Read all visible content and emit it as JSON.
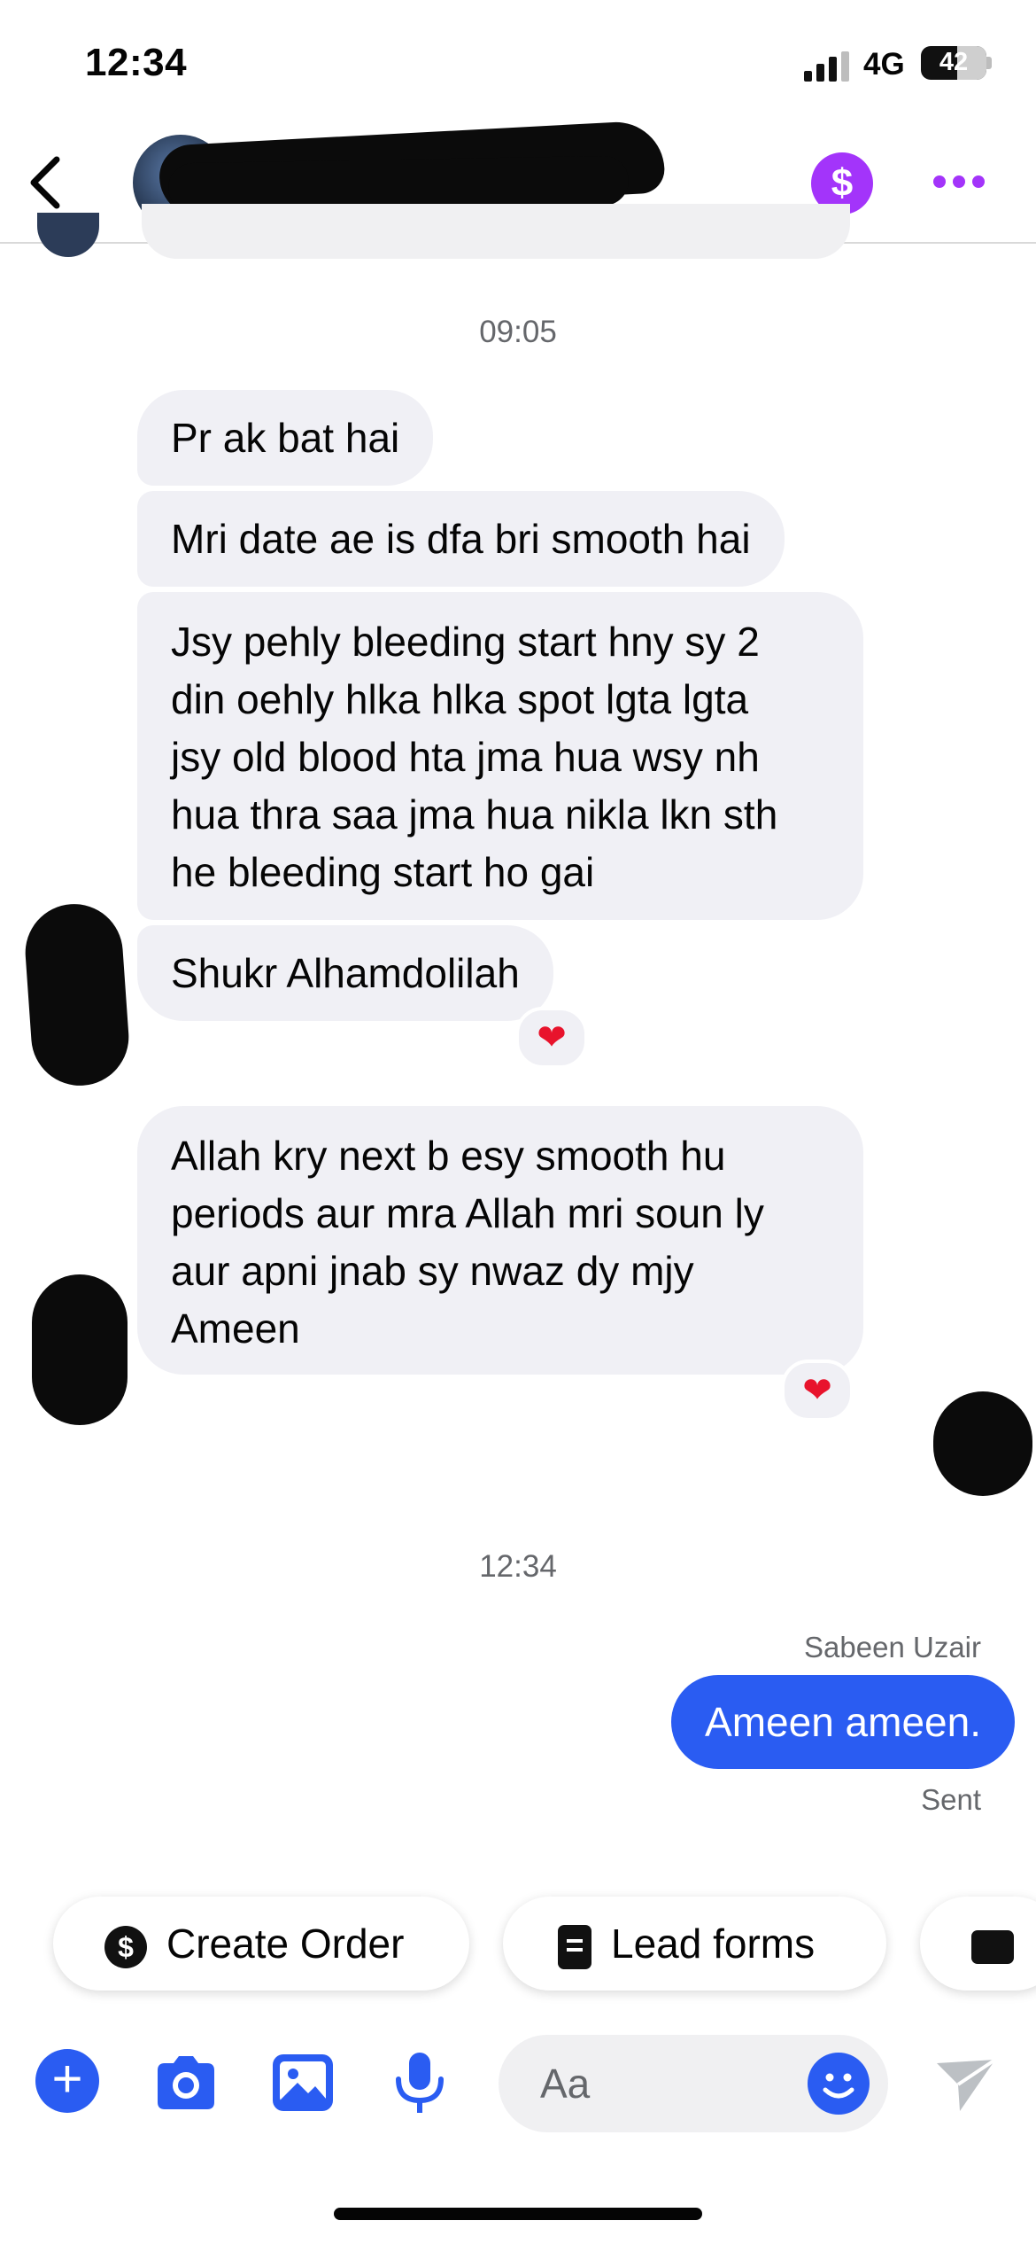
{
  "status_bar": {
    "time": "12:34",
    "network": "4G",
    "battery": "42"
  },
  "header": {
    "payment_symbol": "$",
    "icons": [
      "back-icon",
      "dollar-icon",
      "more-icon"
    ]
  },
  "chat": {
    "timestamp_1": "09:05",
    "incoming": [
      "Pr ak bat hai",
      "Mri date ae is dfa bri smooth hai",
      "Jsy pehly bleeding start hny sy 2\ndin oehly hlka hlka spot lgta lgta\njsy old blood hta jma hua wsy nh\nhua thra saa jma hua nikla lkn sth\nhe bleeding start ho gai",
      "Shukr Alhamdolilah",
      "Allah kry next b esy smooth hu\nperiods aur mra Allah mri soun ly\naur apni jnab sy nwaz dy mjy\nAmeen"
    ],
    "reaction": "❤",
    "timestamp_2": "12:34",
    "sender_name": "Sabeen Uzair",
    "outgoing": "Ameen ameen.",
    "delivery_status": "Sent"
  },
  "quick_actions": {
    "create_order": "Create Order",
    "lead_forms": "Lead forms",
    "icon_symbol": "$"
  },
  "composer": {
    "placeholder": "Aa",
    "plus": "+"
  },
  "colors": {
    "accent_blue": "#2a5cf2",
    "purple": "#a334fa",
    "bubble_gray": "#f0f0f5",
    "heart": "#e8132c"
  }
}
